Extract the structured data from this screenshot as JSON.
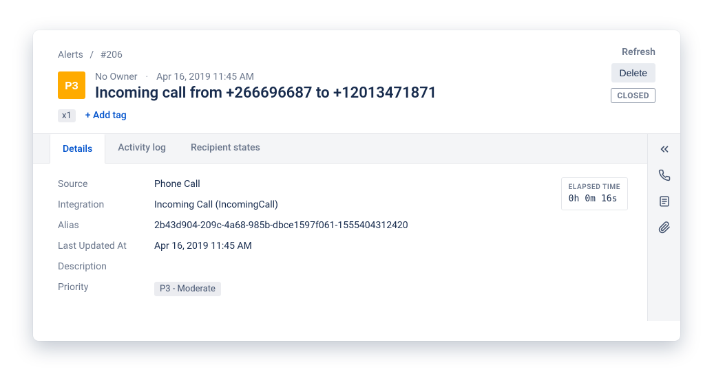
{
  "breadcrumb": {
    "root": "Alerts",
    "sep": "/",
    "id": "#206"
  },
  "actions": {
    "refresh": "Refresh",
    "delete": "Delete",
    "status": "CLOSED"
  },
  "alert": {
    "priority_chip": "P3",
    "owner": "No Owner",
    "timestamp": "Apr 16, 2019 11:45 AM",
    "title": "Incoming call from +266696687 to +12013471871",
    "count": "x1",
    "add_tag": "+ Add tag"
  },
  "tabs": [
    {
      "label": "Details",
      "active": true
    },
    {
      "label": "Activity log",
      "active": false
    },
    {
      "label": "Recipient states",
      "active": false
    }
  ],
  "elapsed": {
    "label": "ELAPSED TIME",
    "h": "0h",
    "m": "0m",
    "s": "16s"
  },
  "fields": {
    "source": {
      "label": "Source",
      "value": "Phone Call"
    },
    "integration": {
      "label": "Integration",
      "value": "Incoming Call (IncomingCall)"
    },
    "alias": {
      "label": "Alias",
      "value": "2b43d904-209c-4a68-985b-dbce1597f061-1555404312420"
    },
    "last_updated": {
      "label": "Last Updated At",
      "value": "Apr 16, 2019 11:45 AM"
    },
    "description": {
      "label": "Description",
      "value": ""
    },
    "priority": {
      "label": "Priority",
      "value": "P3 - Moderate"
    }
  }
}
